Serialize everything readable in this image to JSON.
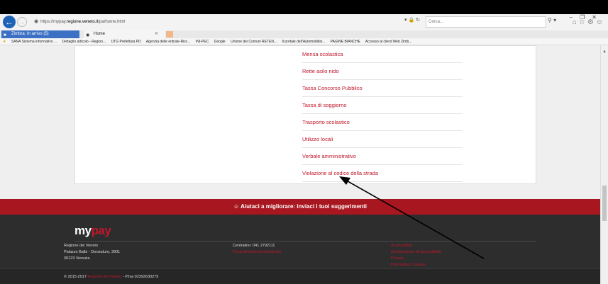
{
  "browser": {
    "url_prefix": "https://mypay.",
    "url_domain": "regione.veneto.it",
    "url_path": "/pa/home.html",
    "search_placeholder": "Cerca...",
    "tabs": [
      {
        "label": "Zimbra: In arrivo (5)"
      },
      {
        "label": "Home"
      }
    ],
    "favorites": [
      "SANA Sistema informativo ...",
      "Dettaglio articolo - Region...",
      "UTG Prefettura PD",
      "Agenzia delle entrate-Risc...",
      "INI-PEC",
      "Google",
      "Unione dei Comuni RETEN...",
      "Il portale dell'Automobilist...",
      "PAGINE BIANCHE",
      "Accesso al client Web Zimb..."
    ]
  },
  "services": [
    "Mensa scolastica",
    "Rette asilo nido",
    "Tassa Concorso Pubblico",
    "Tassa di soggiorno",
    "Trasporto scolastico",
    "Utilizzo locali",
    "Verbale amministrativo",
    "Violazione al codice della strada"
  ],
  "banner": {
    "icon": "☺",
    "text": "Aiutaci a migliorare: inviaci i tuoi suggerimenti"
  },
  "footer": {
    "logo_my": "my",
    "logo_pay": "pay",
    "address": [
      "Regione del Veneto",
      "Palazzo Balbi - Dorsoduro, 3901",
      "30123 Venezia"
    ],
    "phone": "Centralino: 041 2792111",
    "pec": "Posta Elettronica Certificata",
    "links": [
      "Accessibilità",
      "Dichiarazione di accessibilità",
      "Privacy",
      "Informativa Cookies"
    ],
    "copyright_prefix": "© 2015-2017",
    "copyright_link": "Regione del Veneto",
    "copyright_suffix": "- P.Iva 02392630279"
  },
  "colors": {
    "accent_red": "#c0172b",
    "banner_red": "#a8171f",
    "footer_dark": "#2d2d2d"
  }
}
